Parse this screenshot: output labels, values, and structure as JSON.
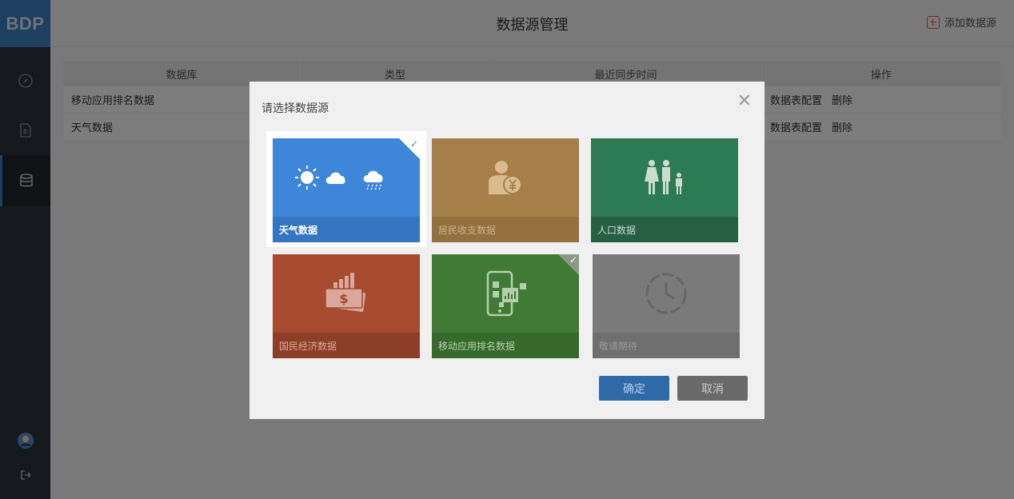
{
  "app": {
    "logo": "BDP",
    "title": "数据源管理",
    "add_label": "添加数据源"
  },
  "table": {
    "headers": [
      "数据库",
      "类型",
      "最近同步时间",
      "操作"
    ],
    "rows": [
      {
        "name": "移动应用排名数据",
        "type": "",
        "time": "",
        "op1": "数据表配置",
        "op2": "删除"
      },
      {
        "name": "天气数据",
        "type": "",
        "time": "",
        "op1": "数据表配置",
        "op2": "删除"
      }
    ]
  },
  "modal": {
    "title": "请选择数据源",
    "tiles": [
      {
        "label": "天气数据",
        "selected": true,
        "checked": true,
        "color": "#3d86d8",
        "icon": "weather-icon"
      },
      {
        "label": "居民收支数据",
        "selected": false,
        "checked": false,
        "color": "#f0a840",
        "icon": "person-yuan-icon"
      },
      {
        "label": "人口数据",
        "selected": false,
        "checked": false,
        "color": "#3a9e6a",
        "icon": "family-icon"
      },
      {
        "label": "国民经济数据",
        "selected": false,
        "checked": false,
        "color": "#e85f3e",
        "icon": "money-chart-icon"
      },
      {
        "label": "移动应用排名数据",
        "selected": false,
        "checked": true,
        "color": "#5cae4a",
        "icon": "mobile-app-icon"
      },
      {
        "label": "敬请期待",
        "selected": false,
        "checked": false,
        "color": "#d9d9d9",
        "icon": "clock-icon"
      }
    ],
    "confirm": "确定",
    "cancel": "取消"
  }
}
